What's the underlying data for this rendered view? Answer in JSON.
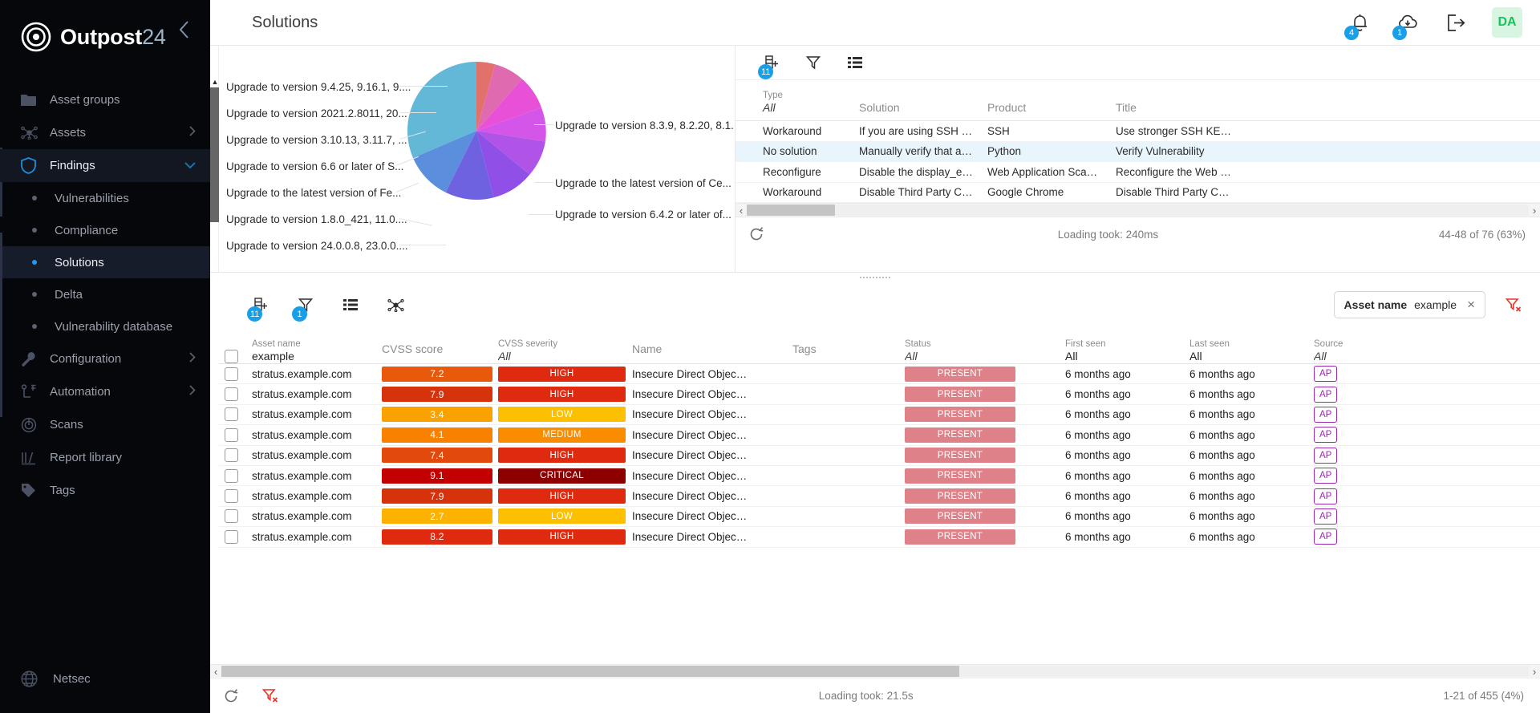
{
  "brand": {
    "name": "Outpost",
    "suffix": "24"
  },
  "sidebar": {
    "items": [
      {
        "label": "Asset groups",
        "icon": "folder-icon",
        "expandable": false
      },
      {
        "label": "Assets",
        "icon": "nodes-icon",
        "expandable": true
      },
      {
        "label": "Findings",
        "icon": "shield-icon",
        "expandable": true,
        "active": true
      }
    ],
    "findings_sub": [
      {
        "label": "Vulnerabilities",
        "active": false
      },
      {
        "label": "Compliance",
        "active": false
      },
      {
        "label": "Solutions",
        "active": true
      },
      {
        "label": "Delta",
        "active": false
      },
      {
        "label": "Vulnerability database",
        "active": false
      }
    ],
    "items_after": [
      {
        "label": "Configuration",
        "icon": "wrench-icon",
        "expandable": true
      },
      {
        "label": "Automation",
        "icon": "automation-icon",
        "expandable": true
      },
      {
        "label": "Scans",
        "icon": "scan-icon",
        "expandable": false
      },
      {
        "label": "Report library",
        "icon": "library-icon",
        "expandable": false
      },
      {
        "label": "Tags",
        "icon": "tag-icon",
        "expandable": false
      }
    ],
    "bottom": {
      "label": "Netsec",
      "icon": "globe-icon"
    }
  },
  "header": {
    "title": "Solutions",
    "notifications_count": "4",
    "downloads_count": "1",
    "avatar_initials": "DA"
  },
  "chart_data": {
    "type": "pie",
    "title": "",
    "legend_position": "labels-around",
    "categories": [
      "Upgrade to version 9.4.25, 9.16.1, 9....",
      "Upgrade to version 2021.2.8011, 20...",
      "Upgrade to version 3.10.13, 3.11.7, ...",
      "Upgrade to version 6.6 or later of S...",
      "Upgrade to the latest version of Fe...",
      "Upgrade to version 1.8.0_421, 11.0....",
      "Upgrade to version 24.0.0.8, 23.0.0....",
      "Upgrade to version 8.3.9, 8.2.20, 8.1...",
      "Upgrade to the latest version of Ce...",
      "Upgrade to version 6.4.2 or later of..."
    ],
    "values": [
      4.5,
      9.5,
      10.5,
      11.5,
      9.5,
      11.5,
      13.0,
      9.5,
      20.5,
      0
    ],
    "colors": [
      "#e2706b",
      "#e06ab0",
      "#e950d8",
      "#d456e8",
      "#b054e8",
      "#9050e8",
      "#6e62e0",
      "#5b8fdd",
      "#63b8d8",
      "#cfd8dc"
    ]
  },
  "solutions_grid": {
    "toolbar": {
      "columns_badge": "11",
      "filter_badge": "",
      "icons": [
        "add-column-icon",
        "filter-icon",
        "list-view-icon"
      ]
    },
    "columns": [
      {
        "sub": "Type",
        "value": "All"
      },
      {
        "label": "Solution"
      },
      {
        "label": "Product"
      },
      {
        "label": "Title"
      }
    ],
    "rows": [
      {
        "type": "Workaround",
        "solution": "If you are using SSH …",
        "product": "SSH",
        "title": "Use stronger SSH KE…",
        "selected": false
      },
      {
        "type": "No solution",
        "solution": "Manually verify that a…",
        "product": "Python",
        "title": "Verify Vulnerability",
        "selected": true
      },
      {
        "type": "Reconfigure",
        "solution": "Disable the display_e…",
        "product": "Web Application Sca…",
        "title": "Reconfigure the Web …",
        "selected": false
      },
      {
        "type": "Workaround",
        "solution": "Disable Third Party C…",
        "product": "Google Chrome",
        "title": "Disable Third Party C…",
        "selected": false
      }
    ],
    "footer": {
      "loading": "Loading took: 240ms",
      "range": "44-48 of 76 (63%)"
    }
  },
  "findings_table": {
    "toolbar": {
      "columns_badge": "11",
      "filter_badge": "1",
      "icons": [
        "add-column-icon",
        "filter-icon",
        "list-view-icon",
        "graph-view-icon"
      ]
    },
    "chip": {
      "field": "Asset name",
      "value": "example",
      "clear": "×"
    },
    "clear_filters_icon": "clear-filter-icon",
    "columns": [
      {
        "sub": "Asset name",
        "value": "example"
      },
      {
        "label": "CVSS score"
      },
      {
        "sub": "CVSS severity",
        "value": "All"
      },
      {
        "label": "Name"
      },
      {
        "label": "Tags"
      },
      {
        "sub": "Status",
        "value": "All"
      },
      {
        "sub": "First seen",
        "value": "All"
      },
      {
        "sub": "Last seen",
        "value": "All"
      },
      {
        "sub": "Source",
        "value": "All"
      }
    ],
    "rows": [
      {
        "asset": "stratus.example.com",
        "score": "7.2",
        "score_color": "#e8590c",
        "severity": "HIGH",
        "sev_color": "#e02a10",
        "name": "Insecure Direct Objec…",
        "tags": "",
        "status": "PRESENT",
        "first_seen": "6 months ago",
        "last_seen": "6 months ago",
        "source": "AP"
      },
      {
        "asset": "stratus.example.com",
        "score": "7.9",
        "score_color": "#d6330c",
        "severity": "HIGH",
        "sev_color": "#e02a10",
        "name": "Insecure Direct Objec…",
        "tags": "",
        "status": "PRESENT",
        "first_seen": "6 months ago",
        "last_seen": "6 months ago",
        "source": "AP"
      },
      {
        "asset": "stratus.example.com",
        "score": "3.4",
        "score_color": "#f9a201",
        "severity": "LOW",
        "sev_color": "#fcc000",
        "name": "Insecure Direct Objec…",
        "tags": "",
        "status": "PRESENT",
        "first_seen": "6 months ago",
        "last_seen": "6 months ago",
        "source": "AP"
      },
      {
        "asset": "stratus.example.com",
        "score": "4.1",
        "score_color": "#f98100",
        "severity": "MEDIUM",
        "sev_color": "#fa8c00",
        "name": "Insecure Direct Objec…",
        "tags": "",
        "status": "PRESENT",
        "first_seen": "6 months ago",
        "last_seen": "6 months ago",
        "source": "AP"
      },
      {
        "asset": "stratus.example.com",
        "score": "7.4",
        "score_color": "#e2490c",
        "severity": "HIGH",
        "sev_color": "#e02a10",
        "name": "Insecure Direct Objec…",
        "tags": "",
        "status": "PRESENT",
        "first_seen": "6 months ago",
        "last_seen": "6 months ago",
        "source": "AP"
      },
      {
        "asset": "stratus.example.com",
        "score": "9.1",
        "score_color": "#c20000",
        "severity": "CRITICAL",
        "sev_color": "#8e0000",
        "name": "Insecure Direct Objec…",
        "tags": "",
        "status": "PRESENT",
        "first_seen": "6 months ago",
        "last_seen": "6 months ago",
        "source": "AP"
      },
      {
        "asset": "stratus.example.com",
        "score": "7.9",
        "score_color": "#d6330c",
        "severity": "HIGH",
        "sev_color": "#e02a10",
        "name": "Insecure Direct Objec…",
        "tags": "",
        "status": "PRESENT",
        "first_seen": "6 months ago",
        "last_seen": "6 months ago",
        "source": "AP"
      },
      {
        "asset": "stratus.example.com",
        "score": "2.7",
        "score_color": "#fbb201",
        "severity": "LOW",
        "sev_color": "#fcc000",
        "name": "Insecure Direct Objec…",
        "tags": "",
        "status": "PRESENT",
        "first_seen": "6 months ago",
        "last_seen": "6 months ago",
        "source": "AP"
      },
      {
        "asset": "stratus.example.com",
        "score": "8.2",
        "score_color": "#e02a10",
        "severity": "HIGH",
        "sev_color": "#e02a10",
        "name": "Insecure Direct Objec…",
        "tags": "",
        "status": "PRESENT",
        "first_seen": "6 months ago",
        "last_seen": "6 months ago",
        "source": "AP"
      }
    ],
    "footer": {
      "loading": "Loading took: 21.5s",
      "range": "1-21 of 455 (4%)"
    }
  },
  "colors": {
    "accent": "#199ee8",
    "sidebar_bg": "#05070b",
    "active_nav": "#121722"
  }
}
